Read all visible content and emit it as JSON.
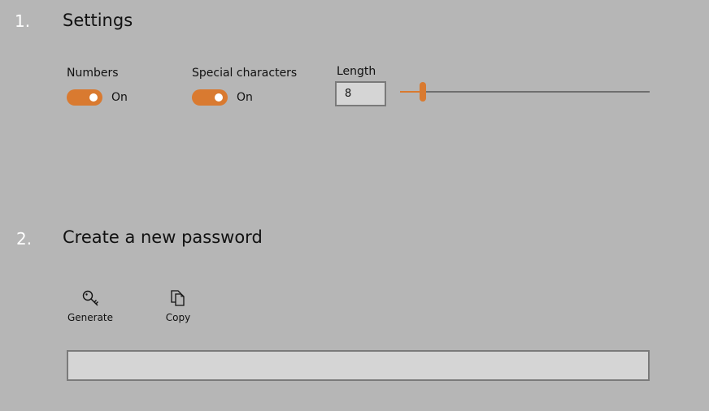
{
  "settings": {
    "number": "1.",
    "title": "Settings",
    "numbers": {
      "label": "Numbers",
      "state": "On",
      "on": true
    },
    "special_characters": {
      "label": "Special characters",
      "state": "On",
      "on": true
    },
    "length": {
      "label": "Length",
      "value": "8",
      "slider_fraction": 0.09
    }
  },
  "create": {
    "number": "2.",
    "title": "Create a new password",
    "generate": {
      "label": "Generate",
      "icon": "key-icon"
    },
    "copy": {
      "label": "Copy",
      "icon": "copy-icon"
    },
    "password": {
      "value": ""
    }
  },
  "colors": {
    "background": "#b6b6b6",
    "accent": "#d97a30",
    "section_number": "#ffffff",
    "field_background": "#d5d5d5"
  }
}
